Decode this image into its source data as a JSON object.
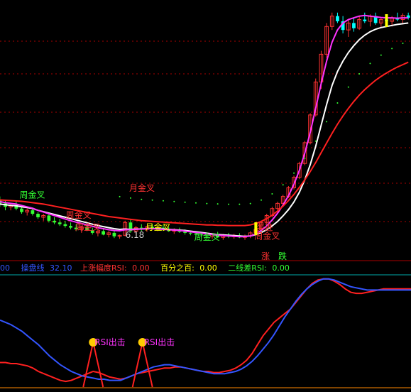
{
  "buttons": {
    "up": "涨",
    "down": "跌"
  },
  "indicator_bar": {
    "lead_value": "00",
    "cao_pan_label": "操盘线",
    "cao_pan_value": "32.10",
    "rsi_label": "上涨幅度RSI:",
    "rsi_value": "0.00",
    "pct_label": "百分之百:",
    "pct_value": "0.00",
    "diff_label": "二线差RSI:",
    "diff_value": "0.00"
  },
  "colors": {
    "bg": "#000000",
    "up": "#ff3232",
    "down": "#00ffff",
    "white_line": "#ffffff",
    "magenta_line": "#ff33ff",
    "red_line": "#ff2020",
    "green_text": "#33ff33",
    "blue_line": "#3355ff",
    "yellow": "#ffff00",
    "grid": "#aa0000"
  },
  "chart_data": [
    {
      "type": "candlestick",
      "title": "",
      "annotations": [
        {
          "text": "月金叉",
          "color": "#ff3232",
          "at_index": 24
        },
        {
          "text": "周金叉",
          "color": "#33ff33",
          "at_index": 7
        },
        {
          "text": "周金叉",
          "color": "#ff3232",
          "at_index": 16
        },
        {
          "text": "周金叉",
          "color": "#ff3232",
          "at_index": 18
        },
        {
          "text": "月金叉",
          "color": "#ffff00",
          "at_index": 28
        },
        {
          "text": "周金叉",
          "color": "#33ff33",
          "at_index": 37
        },
        {
          "text": "买进",
          "color": "#ff3232",
          "at_index": 47
        },
        {
          "text": "周金叉",
          "color": "#ff3232",
          "at_index": 47
        },
        {
          "text": "6.18",
          "color": "#cccccc",
          "at_index": 22
        }
      ],
      "candles": [
        [
          7.3,
          7.4,
          7.1,
          7.2
        ],
        [
          7.2,
          7.3,
          7.0,
          7.1
        ],
        [
          7.1,
          7.2,
          7.0,
          7.15
        ],
        [
          7.15,
          7.25,
          7.0,
          7.05
        ],
        [
          7.05,
          7.1,
          6.9,
          6.95
        ],
        [
          6.95,
          7.05,
          6.85,
          7.0
        ],
        [
          7.0,
          7.05,
          6.85,
          6.9
        ],
        [
          6.9,
          6.95,
          6.75,
          6.8
        ],
        [
          6.8,
          6.9,
          6.7,
          6.85
        ],
        [
          6.85,
          6.9,
          6.65,
          6.7
        ],
        [
          6.7,
          6.8,
          6.6,
          6.65
        ],
        [
          6.65,
          6.75,
          6.55,
          6.6
        ],
        [
          6.6,
          6.7,
          6.5,
          6.55
        ],
        [
          6.55,
          6.65,
          6.45,
          6.5
        ],
        [
          6.5,
          6.6,
          6.4,
          6.45
        ],
        [
          6.45,
          6.55,
          6.35,
          6.52
        ],
        [
          6.52,
          6.6,
          6.4,
          6.42
        ],
        [
          6.42,
          6.5,
          6.3,
          6.35
        ],
        [
          6.35,
          6.45,
          6.25,
          6.4
        ],
        [
          6.4,
          6.45,
          6.28,
          6.3
        ],
        [
          6.3,
          6.4,
          6.22,
          6.35
        ],
        [
          6.35,
          6.4,
          6.2,
          6.25
        ],
        [
          6.25,
          6.3,
          6.18,
          6.28
        ],
        [
          6.28,
          6.7,
          6.25,
          6.65
        ],
        [
          6.65,
          6.75,
          6.35,
          6.4
        ],
        [
          6.4,
          6.55,
          6.3,
          6.5
        ],
        [
          6.5,
          6.6,
          6.4,
          6.45
        ],
        [
          6.45,
          6.55,
          6.38,
          6.52
        ],
        [
          6.52,
          6.6,
          6.45,
          6.48
        ],
        [
          6.48,
          6.56,
          6.4,
          6.5
        ],
        [
          6.5,
          6.58,
          6.42,
          6.45
        ],
        [
          6.45,
          6.52,
          6.38,
          6.4
        ],
        [
          6.4,
          6.48,
          6.32,
          6.45
        ],
        [
          6.45,
          6.5,
          6.35,
          6.38
        ],
        [
          6.38,
          6.45,
          6.3,
          6.35
        ],
        [
          6.35,
          6.42,
          6.28,
          6.33
        ],
        [
          6.33,
          6.4,
          6.25,
          6.3
        ],
        [
          6.3,
          6.38,
          6.22,
          6.28
        ],
        [
          6.28,
          6.36,
          6.2,
          6.25
        ],
        [
          6.25,
          6.34,
          6.18,
          6.3
        ],
        [
          6.3,
          6.38,
          6.2,
          6.22
        ],
        [
          6.22,
          6.32,
          6.15,
          6.28
        ],
        [
          6.28,
          6.35,
          6.2,
          6.24
        ],
        [
          6.24,
          6.32,
          6.18,
          6.28
        ],
        [
          6.28,
          6.34,
          6.2,
          6.22
        ],
        [
          6.22,
          6.3,
          6.15,
          6.26
        ],
        [
          6.26,
          6.4,
          6.2,
          6.35
        ],
        [
          6.35,
          6.5,
          6.3,
          6.45
        ],
        [
          6.45,
          6.7,
          6.4,
          6.65
        ],
        [
          6.65,
          6.9,
          6.6,
          6.85
        ],
        [
          6.85,
          7.1,
          6.8,
          7.05
        ],
        [
          7.05,
          7.25,
          7.0,
          7.2
        ],
        [
          7.2,
          7.45,
          7.15,
          7.4
        ],
        [
          7.4,
          7.7,
          7.35,
          7.65
        ],
        [
          7.65,
          8.0,
          7.6,
          7.95
        ],
        [
          7.95,
          8.4,
          7.9,
          8.35
        ],
        [
          8.35,
          9.0,
          8.3,
          8.95
        ],
        [
          8.95,
          9.8,
          8.9,
          9.75
        ],
        [
          9.75,
          10.8,
          9.7,
          10.7
        ],
        [
          10.7,
          11.6,
          10.5,
          11.5
        ],
        [
          11.5,
          12.4,
          11.4,
          12.3
        ],
        [
          12.3,
          12.7,
          12.2,
          12.6
        ],
        [
          12.6,
          12.7,
          12.4,
          12.45
        ],
        [
          12.45,
          12.6,
          12.1,
          12.2
        ],
        [
          12.2,
          12.5,
          12.0,
          12.4
        ],
        [
          12.4,
          12.55,
          12.15,
          12.25
        ],
        [
          12.25,
          12.6,
          12.2,
          12.5
        ],
        [
          12.5,
          12.7,
          12.4,
          12.45
        ],
        [
          12.45,
          12.65,
          12.3,
          12.6
        ],
        [
          12.6,
          12.7,
          12.35,
          12.4
        ],
        [
          12.4,
          12.55,
          12.25,
          12.5
        ],
        [
          12.5,
          12.65,
          12.4,
          12.45
        ],
        [
          12.45,
          12.6,
          12.3,
          12.55
        ],
        [
          12.55,
          12.7,
          12.45,
          12.5
        ],
        [
          12.5,
          12.68,
          12.4,
          12.62
        ],
        [
          12.62,
          12.7,
          12.5,
          12.55
        ]
      ],
      "series": [
        {
          "name": "",
          "color": "#ffffff",
          "values": [
            7.18,
            7.16,
            7.14,
            7.13,
            7.1,
            7.08,
            7.05,
            7.0,
            6.96,
            6.92,
            6.88,
            6.84,
            6.8,
            6.76,
            6.72,
            6.68,
            6.64,
            6.6,
            6.56,
            6.53,
            6.5,
            6.47,
            6.45,
            6.46,
            6.45,
            6.46,
            6.46,
            6.47,
            6.47,
            6.47,
            6.46,
            6.45,
            6.44,
            6.43,
            6.42,
            6.4,
            6.38,
            6.36,
            6.34,
            6.32,
            6.3,
            6.29,
            6.28,
            6.27,
            6.26,
            6.25,
            6.26,
            6.3,
            6.36,
            6.44,
            6.55,
            6.68,
            6.84,
            7.02,
            7.24,
            7.52,
            7.88,
            8.32,
            8.85,
            9.45,
            10.05,
            10.6,
            11.0,
            11.3,
            11.55,
            11.75,
            11.92,
            12.05,
            12.15,
            12.22,
            12.27,
            12.3,
            12.33,
            12.36,
            12.38,
            12.4
          ]
        },
        {
          "name": "",
          "color": "#ff33ff",
          "values": [
            7.25,
            7.22,
            7.2,
            7.18,
            7.14,
            7.1,
            7.06,
            7.0,
            6.95,
            6.9,
            6.85,
            6.8,
            6.75,
            6.7,
            6.66,
            6.62,
            6.58,
            6.54,
            6.5,
            6.47,
            6.44,
            6.42,
            6.41,
            6.44,
            6.44,
            6.45,
            6.46,
            6.47,
            6.47,
            6.46,
            6.45,
            6.44,
            6.43,
            6.42,
            6.4,
            6.38,
            6.36,
            6.34,
            6.32,
            6.3,
            6.28,
            6.27,
            6.26,
            6.25,
            6.24,
            6.24,
            6.26,
            6.32,
            6.42,
            6.55,
            6.72,
            6.92,
            7.15,
            7.42,
            7.75,
            8.15,
            8.65,
            9.25,
            9.95,
            10.65,
            11.3,
            11.85,
            12.2,
            12.4,
            12.5,
            12.55,
            12.6,
            12.62,
            12.6,
            12.58,
            12.56,
            12.55,
            12.55,
            12.54,
            12.55,
            12.55
          ]
        },
        {
          "name": "",
          "color": "#ff2020",
          "values": [
            7.3,
            7.29,
            7.28,
            7.27,
            7.26,
            7.24,
            7.22,
            7.2,
            7.18,
            7.15,
            7.12,
            7.09,
            7.06,
            7.03,
            7.0,
            6.97,
            6.94,
            6.91,
            6.88,
            6.85,
            6.82,
            6.8,
            6.78,
            6.76,
            6.74,
            6.72,
            6.7,
            6.69,
            6.68,
            6.67,
            6.66,
            6.65,
            6.64,
            6.63,
            6.62,
            6.61,
            6.6,
            6.59,
            6.58,
            6.58,
            6.57,
            6.57,
            6.56,
            6.56,
            6.56,
            6.56,
            6.58,
            6.62,
            6.68,
            6.76,
            6.86,
            6.98,
            7.12,
            7.28,
            7.46,
            7.66,
            7.88,
            8.12,
            8.38,
            8.66,
            8.94,
            9.22,
            9.48,
            9.72,
            9.94,
            10.14,
            10.32,
            10.48,
            10.62,
            10.75,
            10.86,
            10.96,
            11.05,
            11.13,
            11.2,
            11.27
          ]
        }
      ]
    },
    {
      "type": "line",
      "title": "",
      "labels": [
        {
          "text": "RSI出击",
          "at_index": 17
        },
        {
          "text": "RSI出击",
          "at_index": 26
        }
      ],
      "series": [
        {
          "name": "",
          "color": "#ff2020",
          "values": [
            22,
            22,
            21,
            21,
            20,
            19,
            17,
            14,
            12,
            10,
            8,
            6,
            5,
            6,
            8,
            10,
            12,
            14,
            13,
            11,
            9,
            8,
            7,
            8,
            10,
            12,
            13,
            14,
            15,
            16,
            17,
            17,
            18,
            18,
            17,
            16,
            15,
            14,
            14,
            13,
            13,
            14,
            15,
            17,
            20,
            24,
            30,
            38,
            46,
            52,
            58,
            62,
            66,
            70,
            76,
            82,
            88,
            93,
            96,
            97,
            97,
            95,
            92,
            88,
            85,
            84,
            84,
            85,
            86,
            87,
            88,
            88,
            88,
            88,
            88,
            88
          ]
        },
        {
          "name": "",
          "color": "#3355ff",
          "values": [
            60,
            58,
            56,
            53,
            50,
            46,
            42,
            38,
            33,
            28,
            24,
            20,
            17,
            14,
            12,
            10,
            9,
            8,
            7,
            7,
            6,
            6,
            6,
            8,
            10,
            12,
            14,
            16,
            18,
            19,
            20,
            20,
            19,
            18,
            17,
            16,
            15,
            14,
            13,
            12,
            12,
            12,
            13,
            14,
            16,
            19,
            23,
            28,
            34,
            40,
            47,
            55,
            63,
            70,
            77,
            83,
            88,
            92,
            95,
            97,
            97,
            96,
            94,
            92,
            90,
            89,
            88,
            87,
            87,
            87,
            87,
            87,
            87,
            87,
            87,
            87
          ]
        }
      ]
    }
  ]
}
